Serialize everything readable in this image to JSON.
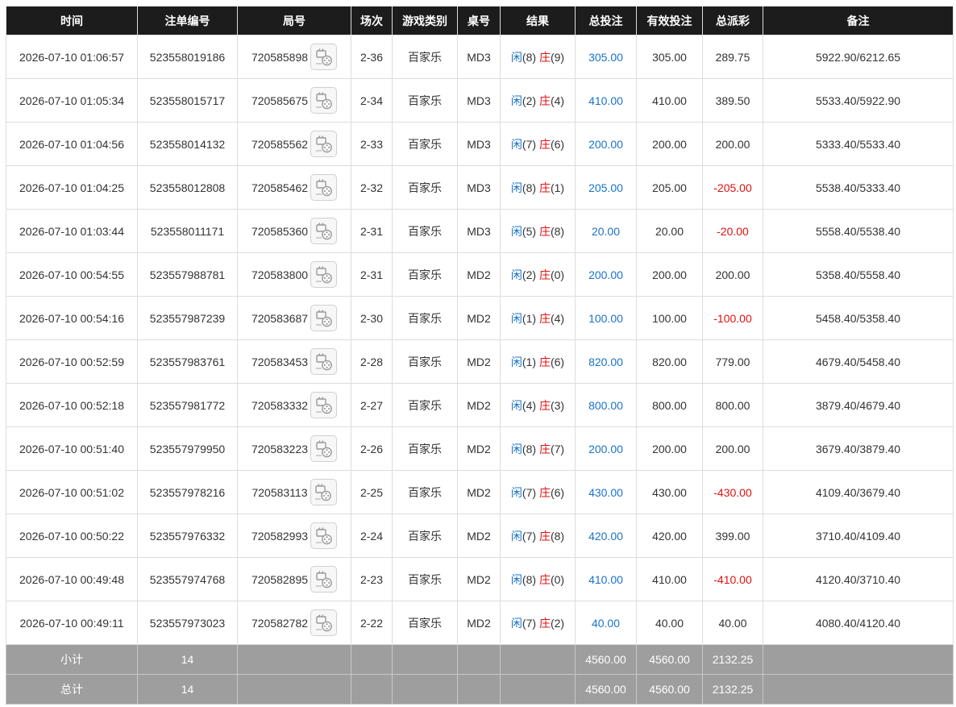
{
  "columns": [
    "时间",
    "注单编号",
    "局号",
    "场次",
    "游戏类别",
    "桌号",
    "结果",
    "总投注",
    "有效投注",
    "总派彩",
    "备注"
  ],
  "result_labels": {
    "player": "闲",
    "banker": "庄"
  },
  "rows": [
    {
      "time": "2026-07-10 01:06:57",
      "bet_id": "523558019186",
      "round": "720585898",
      "session": "2-36",
      "game": "百家乐",
      "table": "MD3",
      "player": "(8)",
      "banker": "(9)",
      "total_bet": "305.00",
      "valid_bet": "305.00",
      "payout": "289.75",
      "payout_negative": false,
      "note": "5922.90/6212.65"
    },
    {
      "time": "2026-07-10 01:05:34",
      "bet_id": "523558015717",
      "round": "720585675",
      "session": "2-34",
      "game": "百家乐",
      "table": "MD3",
      "player": "(2)",
      "banker": "(4)",
      "total_bet": "410.00",
      "valid_bet": "410.00",
      "payout": "389.50",
      "payout_negative": false,
      "note": "5533.40/5922.90"
    },
    {
      "time": "2026-07-10 01:04:56",
      "bet_id": "523558014132",
      "round": "720585562",
      "session": "2-33",
      "game": "百家乐",
      "table": "MD3",
      "player": "(7)",
      "banker": "(6)",
      "total_bet": "200.00",
      "valid_bet": "200.00",
      "payout": "200.00",
      "payout_negative": false,
      "note": "5333.40/5533.40"
    },
    {
      "time": "2026-07-10 01:04:25",
      "bet_id": "523558012808",
      "round": "720585462",
      "session": "2-32",
      "game": "百家乐",
      "table": "MD3",
      "player": "(8)",
      "banker": "(1)",
      "total_bet": "205.00",
      "valid_bet": "205.00",
      "payout": "-205.00",
      "payout_negative": true,
      "note": "5538.40/5333.40"
    },
    {
      "time": "2026-07-10 01:03:44",
      "bet_id": "523558011171",
      "round": "720585360",
      "session": "2-31",
      "game": "百家乐",
      "table": "MD3",
      "player": "(5)",
      "banker": "(8)",
      "total_bet": "20.00",
      "valid_bet": "20.00",
      "payout": "-20.00",
      "payout_negative": true,
      "note": "5558.40/5538.40"
    },
    {
      "time": "2026-07-10 00:54:55",
      "bet_id": "523557988781",
      "round": "720583800",
      "session": "2-31",
      "game": "百家乐",
      "table": "MD2",
      "player": "(2)",
      "banker": "(0)",
      "total_bet": "200.00",
      "valid_bet": "200.00",
      "payout": "200.00",
      "payout_negative": false,
      "note": "5358.40/5558.40"
    },
    {
      "time": "2026-07-10 00:54:16",
      "bet_id": "523557987239",
      "round": "720583687",
      "session": "2-30",
      "game": "百家乐",
      "table": "MD2",
      "player": "(1)",
      "banker": "(4)",
      "total_bet": "100.00",
      "valid_bet": "100.00",
      "payout": "-100.00",
      "payout_negative": true,
      "note": "5458.40/5358.40"
    },
    {
      "time": "2026-07-10 00:52:59",
      "bet_id": "523557983761",
      "round": "720583453",
      "session": "2-28",
      "game": "百家乐",
      "table": "MD2",
      "player": "(1)",
      "banker": "(6)",
      "total_bet": "820.00",
      "valid_bet": "820.00",
      "payout": "779.00",
      "payout_negative": false,
      "note": "4679.40/5458.40"
    },
    {
      "time": "2026-07-10 00:52:18",
      "bet_id": "523557981772",
      "round": "720583332",
      "session": "2-27",
      "game": "百家乐",
      "table": "MD2",
      "player": "(4)",
      "banker": "(3)",
      "total_bet": "800.00",
      "valid_bet": "800.00",
      "payout": "800.00",
      "payout_negative": false,
      "note": "3879.40/4679.40"
    },
    {
      "time": "2026-07-10 00:51:40",
      "bet_id": "523557979950",
      "round": "720583223",
      "session": "2-26",
      "game": "百家乐",
      "table": "MD2",
      "player": "(8)",
      "banker": "(7)",
      "total_bet": "200.00",
      "valid_bet": "200.00",
      "payout": "200.00",
      "payout_negative": false,
      "note": "3679.40/3879.40"
    },
    {
      "time": "2026-07-10 00:51:02",
      "bet_id": "523557978216",
      "round": "720583113",
      "session": "2-25",
      "game": "百家乐",
      "table": "MD2",
      "player": "(7)",
      "banker": "(6)",
      "total_bet": "430.00",
      "valid_bet": "430.00",
      "payout": "-430.00",
      "payout_negative": true,
      "note": "4109.40/3679.40"
    },
    {
      "time": "2026-07-10 00:50:22",
      "bet_id": "523557976332",
      "round": "720582993",
      "session": "2-24",
      "game": "百家乐",
      "table": "MD2",
      "player": "(7)",
      "banker": "(8)",
      "total_bet": "420.00",
      "valid_bet": "420.00",
      "payout": "399.00",
      "payout_negative": false,
      "note": "3710.40/4109.40"
    },
    {
      "time": "2026-07-10 00:49:48",
      "bet_id": "523557974768",
      "round": "720582895",
      "session": "2-23",
      "game": "百家乐",
      "table": "MD2",
      "player": "(8)",
      "banker": "(0)",
      "total_bet": "410.00",
      "valid_bet": "410.00",
      "payout": "-410.00",
      "payout_negative": true,
      "note": "4120.40/3710.40"
    },
    {
      "time": "2026-07-10 00:49:11",
      "bet_id": "523557973023",
      "round": "720582782",
      "session": "2-22",
      "game": "百家乐",
      "table": "MD2",
      "player": "(7)",
      "banker": "(2)",
      "total_bet": "40.00",
      "valid_bet": "40.00",
      "payout": "40.00",
      "payout_negative": false,
      "note": "4080.40/4120.40"
    }
  ],
  "summary": [
    {
      "label": "小计",
      "count": "14",
      "total_bet": "4560.00",
      "valid_bet": "4560.00",
      "payout": "2132.25"
    },
    {
      "label": "总计",
      "count": "14",
      "total_bet": "4560.00",
      "valid_bet": "4560.00",
      "payout": "2132.25"
    }
  ],
  "icons": {
    "replay": "video-replay-icon"
  },
  "colors": {
    "header_bg": "#1c1c1c",
    "summary_bg": "#9e9e9e",
    "bet_blue": "#1a73c8",
    "loss_red": "#e01010"
  }
}
